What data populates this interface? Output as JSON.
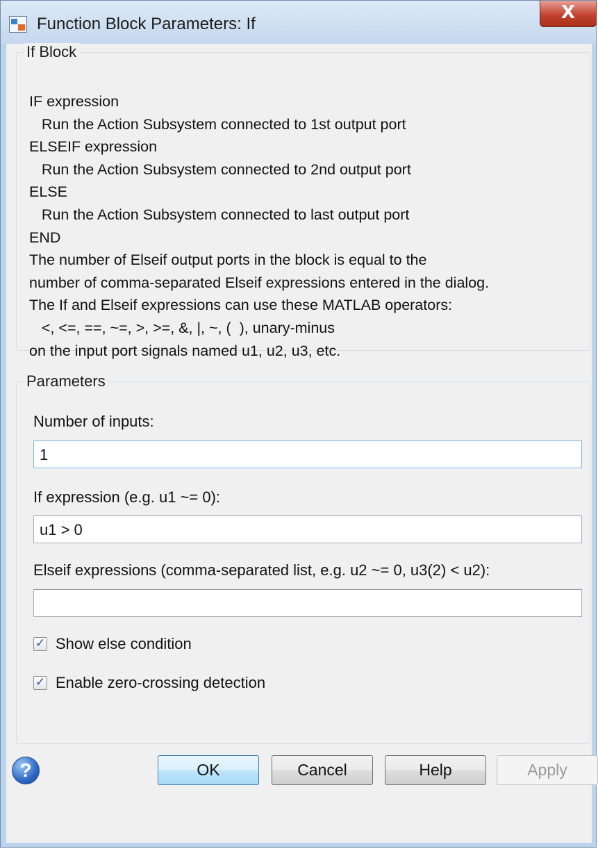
{
  "window": {
    "title": "Function Block Parameters: If",
    "close_label": "X"
  },
  "block_group": {
    "legend": "If Block",
    "description_lines": [
      "IF expression",
      "   Run the Action Subsystem connected to 1st output port",
      "ELSEIF expression",
      "   Run the Action Subsystem connected to 2nd output port",
      "ELSE",
      "   Run the Action Subsystem connected to last output port",
      "END",
      "The number of Elseif output ports in the block is equal to the",
      "number of comma-separated Elseif expressions entered in the dialog.",
      "The If and Elseif expressions can use these MATLAB operators:",
      "   <, <=, ==, ~=, >, >=, &, |, ~, (  ), unary-minus",
      "on the input port signals named u1, u2, u3, etc."
    ]
  },
  "parameters": {
    "legend": "Parameters",
    "num_inputs": {
      "label": "Number of inputs:",
      "value": "1"
    },
    "if_expression": {
      "label": "If expression (e.g. u1 ~= 0):",
      "value": "u1 > 0"
    },
    "elseif_expressions": {
      "label": "Elseif expressions (comma-separated list, e.g. u2 ~= 0, u3(2) < u2):",
      "value": ""
    },
    "show_else": {
      "label": "Show else condition",
      "checked": true
    },
    "zero_crossing": {
      "label": "Enable zero-crossing detection",
      "checked": true
    }
  },
  "buttons": {
    "help_icon": "?",
    "ok": "OK",
    "cancel": "Cancel",
    "help": "Help",
    "apply": "Apply"
  },
  "colors": {
    "accent": "#3c7fb1",
    "focus_border": "#7eb4ea",
    "close_button": "#c2432f"
  }
}
